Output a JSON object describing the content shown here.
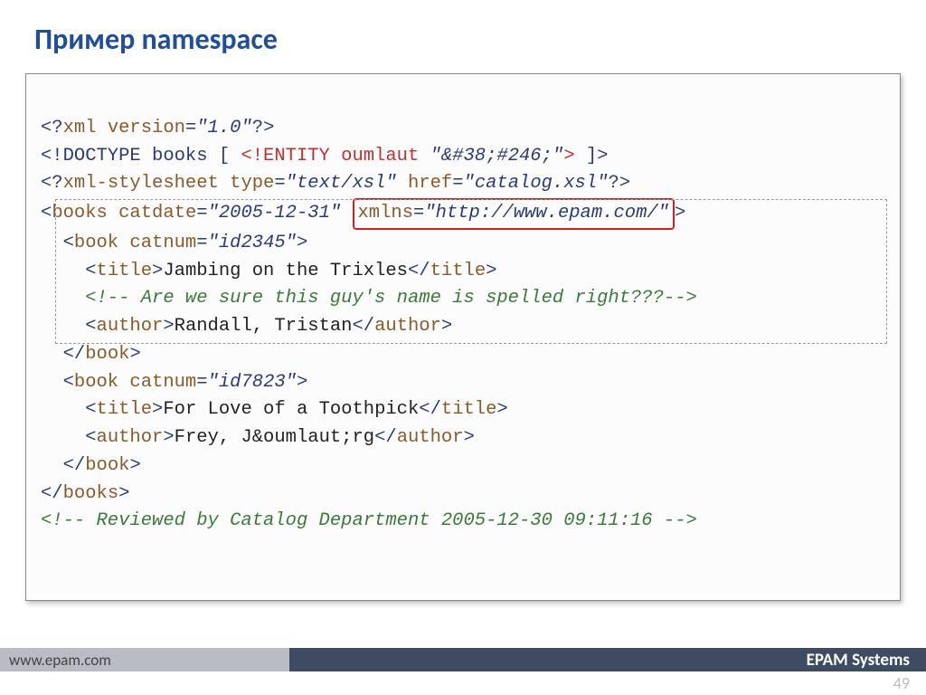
{
  "title": "Пример namespace",
  "code": {
    "l1_a": "<?",
    "l1_b": "xml version",
    "l1_c": "=",
    "l1_d": "\"1.0\"",
    "l1_e": "?>",
    "l2_a": "<!DOCTYPE books [ ",
    "l2_b": "<!ENTITY oumlaut ",
    "l2_c": "\"&#38;#246;\"",
    "l2_d": ">",
    "l2_e": " ]>",
    "l3_a": "<?",
    "l3_b": "xml-stylesheet type",
    "l3_c": "=",
    "l3_d": "\"text/xsl\"",
    "l3_e": " href",
    "l3_f": "=",
    "l3_g": "\"catalog.xsl\"",
    "l3_h": "?>",
    "l4_a": "<",
    "l4_b": "books",
    "l4_c": " catdate",
    "l4_d": "=",
    "l4_e": "\"2005-12-31\"",
    "l4_f": " ",
    "l4_g": "xmlns",
    "l4_h": "=",
    "l4_i": "\"http://www.epam.com/\"",
    "l4_j": ">",
    "l5_a": "  <",
    "l5_b": "book",
    "l5_c": " catnum",
    "l5_d": "=",
    "l5_e": "\"id2345\"",
    "l5_f": ">",
    "l6_a": "    <",
    "l6_b": "title",
    "l6_c": ">",
    "l6_d": "Jambing on the Trixles",
    "l6_e": "</",
    "l6_f": "title",
    "l6_g": ">",
    "l7": "    <!-- Are we sure this guy's name is spelled right???-->",
    "l8_a": "    <",
    "l8_b": "author",
    "l8_c": ">",
    "l8_d": "Randall, Tristan",
    "l8_e": "</",
    "l8_f": "author",
    "l8_g": ">",
    "l9_a": "  </",
    "l9_b": "book",
    "l9_c": ">",
    "l10_a": "  <",
    "l10_b": "book",
    "l10_c": " catnum",
    "l10_d": "=",
    "l10_e": "\"id7823\"",
    "l10_f": ">",
    "l11_a": "    <",
    "l11_b": "title",
    "l11_c": ">",
    "l11_d": "For Love of a Toothpick",
    "l11_e": "</",
    "l11_f": "title",
    "l11_g": ">",
    "l12_a": "    <",
    "l12_b": "author",
    "l12_c": ">",
    "l12_d": "Frey, J&oumlaut;rg",
    "l12_e": "</",
    "l12_f": "author",
    "l12_g": ">",
    "l13_a": "  </",
    "l13_b": "book",
    "l13_c": ">",
    "l14_a": "</",
    "l14_b": "books",
    "l14_c": ">",
    "l15": "<!-- Reviewed by Catalog Department 2005-12-30 09:11:16 -->"
  },
  "footer": {
    "url": "www.epam.com",
    "company": "EPAM Systems"
  },
  "page": "49"
}
